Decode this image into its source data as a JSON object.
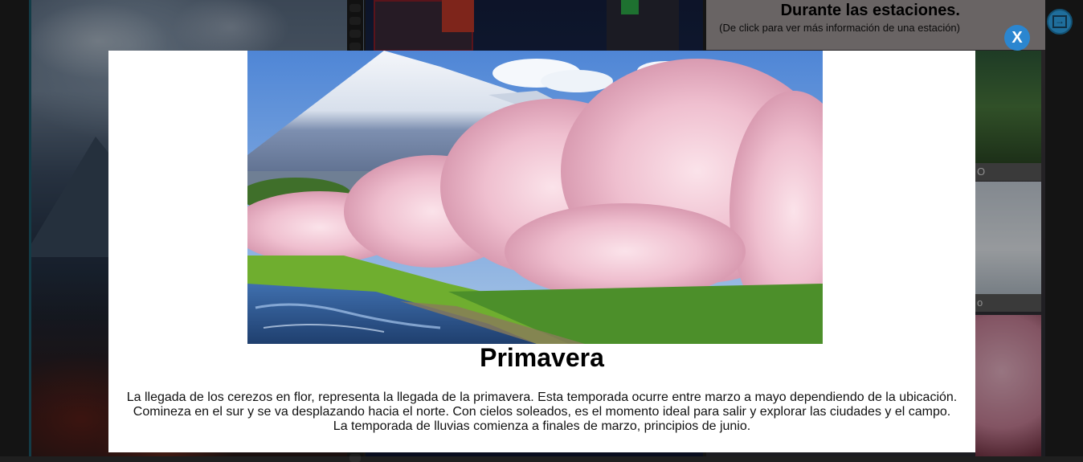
{
  "background": {
    "heading": "Durante las estaciones.",
    "subheading": "(De click para ver más información de una estación)",
    "season_tile_labels": [
      "O",
      "o"
    ]
  },
  "side_button": {
    "icon": "arrow-right-box-icon",
    "glyph": "→"
  },
  "modal": {
    "close_label": "X",
    "image_alt": "Cerezos en flor junto a un río con el monte Fuji al fondo",
    "title": "Primavera",
    "description": "La llegada de los cerezos en flor, representa la llegada de la primavera. Esta temporada ocurre entre marzo a mayo dependiendo de la ubicación. Comineza en el sur y se va desplazando hacia el norte. Con cielos soleados, es el momento ideal para salir y explorar las ciudades y el campo. La temporada de lluvias comienza a finales de marzo, principios de junio."
  },
  "colors": {
    "close_button": "#2b86d0",
    "modal_background": "#ffffff",
    "panel_accent": "#1e5c6e"
  }
}
